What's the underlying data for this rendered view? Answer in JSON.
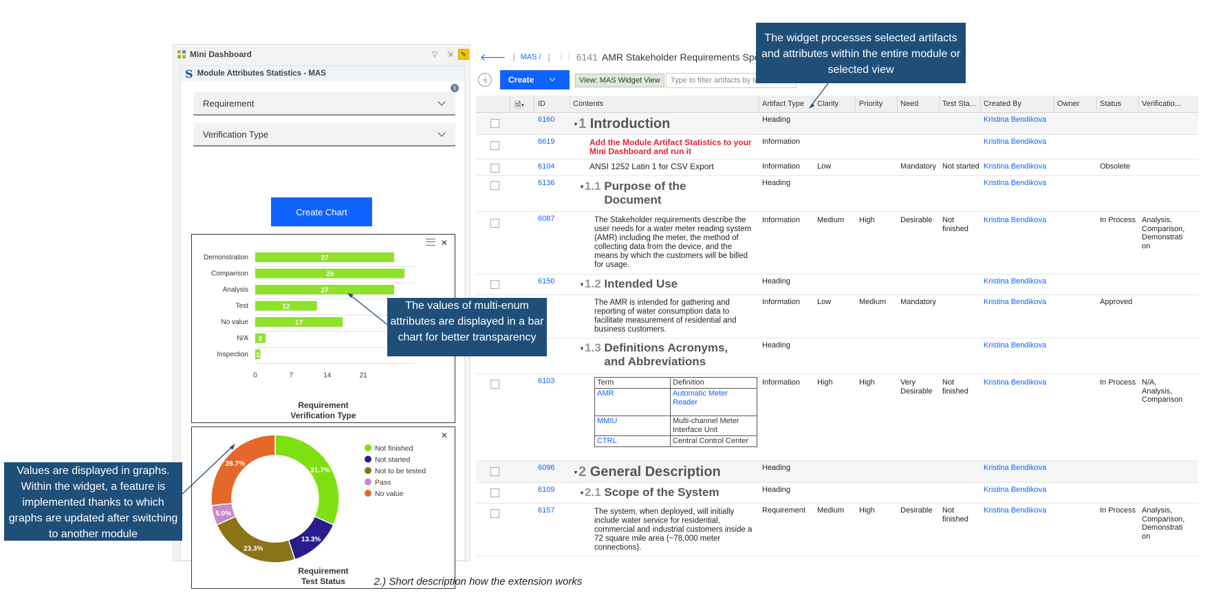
{
  "mini_dashboard": {
    "title": "Mini Dashboard",
    "widget": {
      "title": "Module Attributes Statistics - MAS",
      "dropdown1": "Requirement",
      "dropdown2": "Verification Type",
      "create_chart_label": "Create Chart"
    }
  },
  "chart_data": [
    {
      "type": "bar",
      "orientation": "horizontal",
      "categories": [
        "Demonstration",
        "Comparison",
        "Analysis",
        "Test",
        "No value",
        "N/A",
        "Inspection"
      ],
      "values": [
        27,
        29,
        27,
        12,
        17,
        2,
        1
      ],
      "xticks": [
        "0",
        "7",
        "14",
        "21"
      ],
      "xlim": [
        0,
        31
      ],
      "color": "#8ee22a",
      "title_lines": [
        "Requirement",
        "Verification Type"
      ]
    },
    {
      "type": "pie",
      "donut": true,
      "labels": [
        "Not finished",
        "Not started",
        "Not to be tested",
        "Pass",
        "No value"
      ],
      "values": [
        31.7,
        13.3,
        23.3,
        5.0,
        26.7
      ],
      "value_labels": [
        "31.7%",
        "13.3%",
        "23.3%",
        "5.0%",
        "26.7%"
      ],
      "colors": [
        "#7ee011",
        "#2b1c8c",
        "#8a7416",
        "#c48ac8",
        "#e4682a"
      ],
      "legend_position": "right",
      "title_lines": [
        "Requirement",
        "Test Status"
      ]
    }
  ],
  "module": {
    "breadcrumb": "MAS /",
    "id": "6141",
    "title": "AMR Stakeholder Requirements Specificatio",
    "create_label": "Create",
    "view_prefix": "View:",
    "view_name": "MAS Widget View",
    "filter_placeholder": "Type to filter artifacts by te"
  },
  "columns": [
    "ID",
    "Contents",
    "Artifact Type",
    "Clarity",
    "Priority",
    "Need",
    "Test Sta...",
    "Created By",
    "Owner",
    "Status",
    "Verificatio..."
  ],
  "rows": [
    {
      "id": "6160",
      "num": "1",
      "heading": "Introduction",
      "level": 1,
      "type": "Heading",
      "created": "Kristina Bendikova"
    },
    {
      "id": "6619",
      "text": "Add the Module Artifact Statistics to your Mini Dashboard and run it",
      "type": "Information",
      "created": "Kristina Bendikova"
    },
    {
      "id": "6104",
      "text": "ANSI 1252 Latin 1 for CSV Export",
      "type": "Information",
      "clarity": "Low",
      "need": "Mandatory",
      "test": "Not started",
      "created": "Kristina Bendikova",
      "status": "Obsolete"
    },
    {
      "id": "6136",
      "num": "1.1",
      "heading": "Purpose of the Document",
      "level": 2,
      "type": "Heading",
      "created": "Kristina Bendikova"
    },
    {
      "id": "6087",
      "text": "The Stakeholder requirements describe the user needs for a water meter reading system (AMR) including the meter, the method of collecting data from the device, and the means by which the customers will be billed for usage.",
      "type": "Information",
      "clarity": "Medium",
      "priority": "High",
      "need": "Desirable",
      "test": "Not finished",
      "created": "Kristina Bendikova",
      "status": "In Process",
      "verification": "Analysis, Comparison, Demonstrati on"
    },
    {
      "id": "6150",
      "num": "1.2",
      "heading": "Intended Use",
      "level": 2,
      "type": "Heading",
      "created": "Kristina Bendikova"
    },
    {
      "id": "",
      "text": "The AMR is intended for gathering and reporting of water consumption data to facilitate measurement of residential and business customers.",
      "type": "Information",
      "clarity": "Low",
      "priority": "Medium",
      "need": "Mandatory",
      "created": "Kristina Bendikova",
      "status": "Approved"
    },
    {
      "id": "",
      "num": "1.3",
      "heading": "Definitions Acronyms, and Abbreviations",
      "level": 2,
      "type": "Heading",
      "created": "Kristina Bendikova"
    },
    {
      "id": "6103",
      "type": "Information",
      "clarity": "High",
      "priority": "High",
      "need": "Very Desirable",
      "test": "Not finished",
      "created": "Kristina Bendikova",
      "status": "In Process",
      "verification": "N/A, Analysis, Comparison"
    },
    {
      "id": "6096",
      "num": "2",
      "heading": "General Description",
      "level": 1,
      "type": "Heading",
      "created": "Kristina Bendikova"
    },
    {
      "id": "6109",
      "num": "2.1",
      "heading": "Scope of the System",
      "level": 2,
      "type": "Heading",
      "created": "Kristina Bendikova"
    },
    {
      "id": "6157",
      "text": "The system, when deployed, will initially include water service for residential, commercial and industrial customers inside a 72 square mile area (~78,000 meter connections).",
      "type": "Requirement",
      "clarity": "Medium",
      "priority": "High",
      "need": "Desirable",
      "test": "Not finished",
      "created": "Kristina Bendikova",
      "status": "In Process",
      "verification": "Analysis, Comparison, Demonstrati on"
    }
  ],
  "definitions": {
    "headers": [
      "Term",
      "Definition"
    ],
    "rows": [
      [
        "AMR",
        "Automatic Meter Reader"
      ],
      [
        "MMIU",
        "Multi-channel Meter Interface Unit"
      ],
      [
        "CTRL",
        "Central Control Center"
      ]
    ]
  },
  "callouts": {
    "top": "The widget processes selected artifacts and attributes within the entire module or selected view",
    "middle": "The values of multi-enum attributes are displayed in a bar chart for better transparency",
    "left": "Values are displayed in graphs. Within the widget, a feature is implemented thanks to which graphs are updated after switching to another module"
  },
  "caption": "2.) Short description how the extension works"
}
